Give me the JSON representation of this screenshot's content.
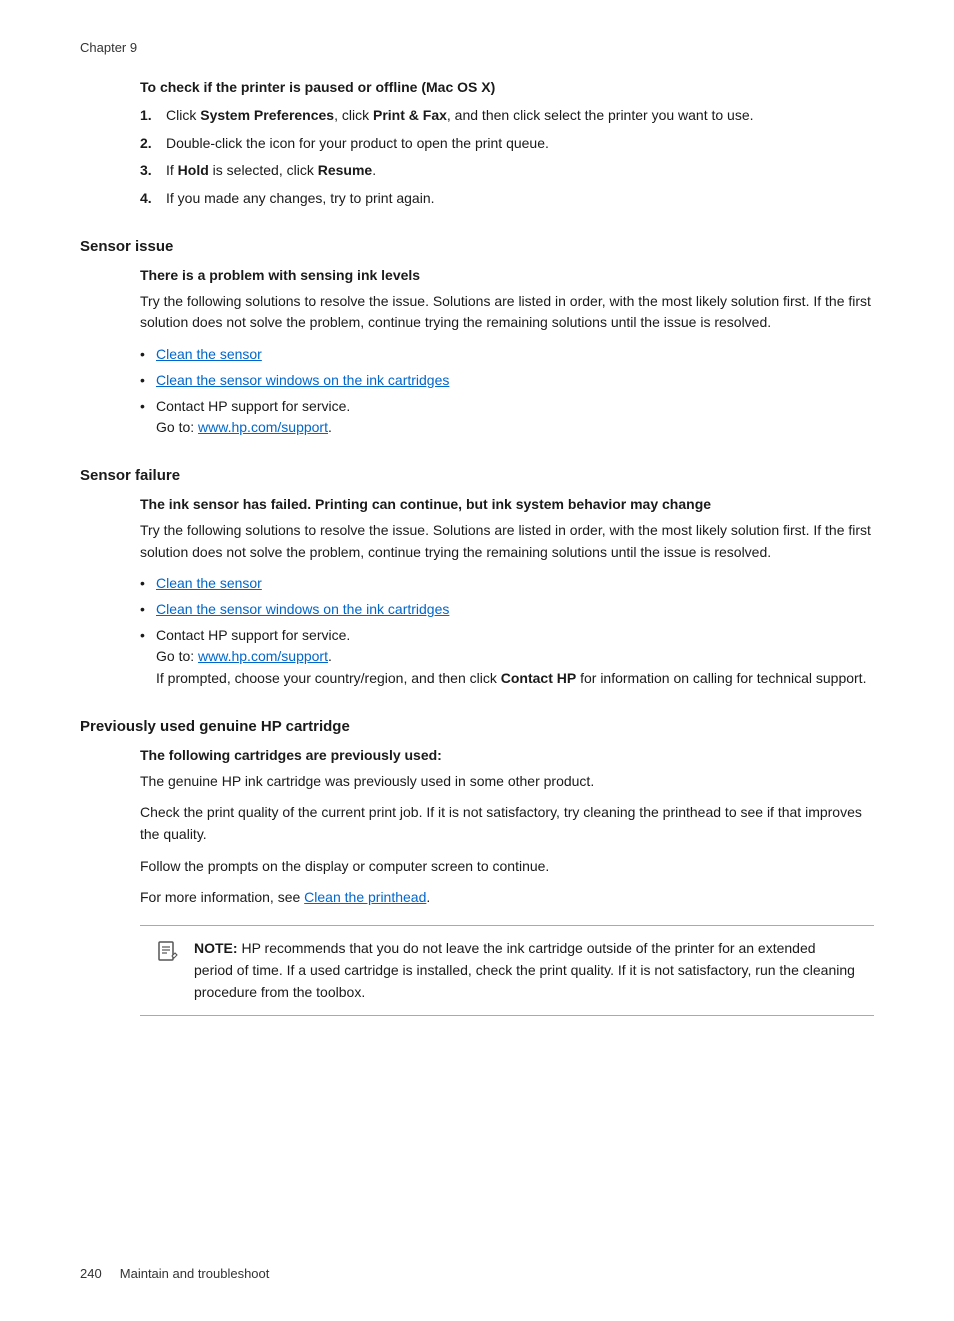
{
  "chapter": {
    "label": "Chapter 9"
  },
  "footer": {
    "page_number": "240",
    "section_label": "Maintain and troubleshoot"
  },
  "to_check_section": {
    "heading": "To check if the printer is paused or offline (Mac OS X)",
    "steps": [
      {
        "num": "1.",
        "text_before": "Click ",
        "bold1": "System Preferences",
        "text_mid": ", click ",
        "bold2": "Print & Fax",
        "text_after": ", and then click select the printer you want to use."
      },
      {
        "num": "2.",
        "text": "Double-click the icon for your product to open the print queue."
      },
      {
        "num": "3.",
        "text_before": "If  ",
        "bold": "Hold",
        "text_after": " is selected, click ",
        "bold2": "Resume",
        "text_end": "."
      },
      {
        "num": "4.",
        "text": "If you made any changes, try to print again."
      }
    ]
  },
  "sensor_issue": {
    "heading": "Sensor issue",
    "subheading": "There is a problem with sensing ink levels",
    "body": "Try the following solutions to resolve the issue. Solutions are listed in order, with the most likely solution first. If the first solution does not solve the problem, continue trying the remaining solutions until the issue is resolved.",
    "bullets": [
      {
        "type": "link",
        "text": "Clean the sensor",
        "href": "#"
      },
      {
        "type": "link",
        "text": "Clean the sensor windows on the ink cartridges",
        "href": "#"
      },
      {
        "type": "text",
        "text": "Contact HP support for service.",
        "sub": "Go to: ",
        "sublink": "www.hp.com/support",
        "sublink_href": "#",
        "subend": "."
      }
    ]
  },
  "sensor_failure": {
    "heading": "Sensor failure",
    "subheading": "The ink sensor has failed. Printing can continue, but ink system behavior may change",
    "body": "Try the following solutions to resolve the issue. Solutions are listed in order, with the most likely solution first. If the first solution does not solve the problem, continue trying the remaining solutions until the issue is resolved.",
    "bullets": [
      {
        "type": "link",
        "text": "Clean the sensor",
        "href": "#"
      },
      {
        "type": "link",
        "text": "Clean the sensor windows on the ink cartridges",
        "href": "#"
      },
      {
        "type": "text",
        "text": "Contact HP support for service.",
        "sub": "Go to: ",
        "sublink": "www.hp.com/support",
        "sublink_href": "#",
        "subend": ".",
        "extra_before": "If prompted, choose your country/region, and then click ",
        "extra_bold": "Contact HP",
        "extra_after": " for information on calling for technical support."
      }
    ]
  },
  "previously_used": {
    "heading": "Previously used genuine HP cartridge",
    "subheading": "The following cartridges are previously used:",
    "paragraphs": [
      "The genuine HP ink cartridge was previously used in some other product.",
      "Check the print quality of the current print job. If it is not satisfactory, try cleaning the printhead to see if that improves the quality.",
      "Follow the prompts on the display or computer screen to continue.",
      "For more information, see "
    ],
    "link_text": "Clean the printhead",
    "link_href": "#",
    "link_after": ".",
    "note": {
      "label": "NOTE:",
      "text": "  HP recommends that you do not leave the ink cartridge outside of the printer for an extended period of time. If a used cartridge is installed, check the print quality. If it is not satisfactory, run the cleaning procedure from the toolbox."
    }
  }
}
